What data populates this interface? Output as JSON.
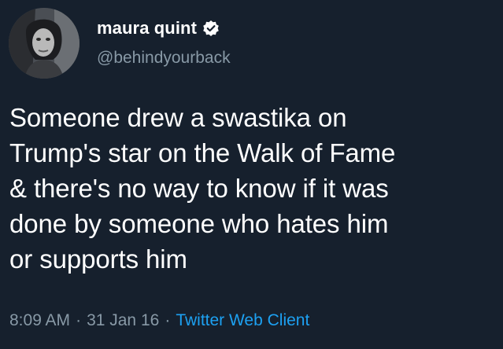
{
  "user": {
    "display_name": "maura quint",
    "handle": "@behindyourback",
    "verified": true,
    "avatar_icon": "profile-photo"
  },
  "tweet": {
    "text": "Someone drew a swastika on\nTrump's star on the Walk of Fame\n& there's no way to know if it was\ndone by someone who hates him\nor supports him"
  },
  "meta": {
    "time": "8:09 AM",
    "separator": "·",
    "date": "31 Jan 16",
    "source": "Twitter Web Client"
  },
  "colors": {
    "background": "#16202d",
    "text": "#ffffff",
    "secondary_text": "#8899a6",
    "link": "#1da1f2"
  }
}
